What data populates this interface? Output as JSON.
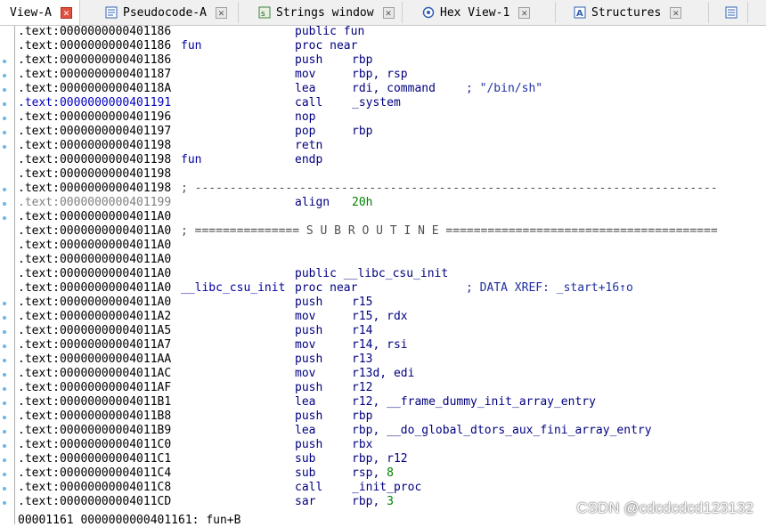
{
  "tabs": [
    {
      "label": "View-A",
      "icon": "ida-view-icon",
      "active": true
    },
    {
      "label": "Pseudocode-A",
      "icon": "pseudocode-icon",
      "active": false
    },
    {
      "label": "Strings window",
      "icon": "strings-icon",
      "active": false
    },
    {
      "label": "Hex View-1",
      "icon": "hex-view-icon",
      "active": false
    },
    {
      "label": "Structures",
      "icon": "structures-icon",
      "active": false
    }
  ],
  "listing": [
    {
      "addr": ".text:0000000000401186",
      "label": "",
      "mnem": "public fun",
      "ops": "",
      "comment": ""
    },
    {
      "addr": ".text:0000000000401186",
      "label": "fun",
      "mnem": "proc near",
      "ops": "",
      "comment": ""
    },
    {
      "addr": ".text:0000000000401186",
      "label": "",
      "mnem": "push",
      "ops": "rbp",
      "comment": ""
    },
    {
      "addr": ".text:0000000000401187",
      "label": "",
      "mnem": "mov",
      "ops": "rbp, rsp",
      "comment": ""
    },
    {
      "addr": ".text:000000000040118A",
      "label": "",
      "mnem": "lea",
      "ops": "rdi, command",
      "comment": "; \"/bin/sh\""
    },
    {
      "addr": ".text:0000000000401191",
      "label": "",
      "mnem": "call",
      "ops": "_system",
      "comment": ""
    },
    {
      "addr": ".text:0000000000401196",
      "label": "",
      "mnem": "nop",
      "ops": "",
      "comment": ""
    },
    {
      "addr": ".text:0000000000401197",
      "label": "",
      "mnem": "pop",
      "ops": "rbp",
      "comment": ""
    },
    {
      "addr": ".text:0000000000401198",
      "label": "",
      "mnem": "retn",
      "ops": "",
      "comment": ""
    },
    {
      "addr": ".text:0000000000401198",
      "label": "fun",
      "mnem": "endp",
      "ops": "",
      "comment": ""
    },
    {
      "addr": ".text:0000000000401198",
      "label": "",
      "mnem": "",
      "ops": "",
      "comment": ""
    },
    {
      "addr": ".text:0000000000401198",
      "sep": "; ---------------------------------------------------------------------------"
    },
    {
      "addr": ".text:0000000000401199",
      "label": "",
      "mnem": "align",
      "ops": "20h",
      "comment": ""
    },
    {
      "addr": ".text:00000000004011A0",
      "label": "",
      "mnem": "",
      "ops": "",
      "comment": ""
    },
    {
      "addr": ".text:00000000004011A0",
      "sep": "; =============== S U B R O U T I N E ======================================="
    },
    {
      "addr": ".text:00000000004011A0",
      "label": "",
      "mnem": "",
      "ops": "",
      "comment": ""
    },
    {
      "addr": ".text:00000000004011A0",
      "label": "",
      "mnem": "",
      "ops": "",
      "comment": ""
    },
    {
      "addr": ".text:00000000004011A0",
      "label": "",
      "mnem": "public __libc_csu_init",
      "ops": "",
      "comment": ""
    },
    {
      "addr": ".text:00000000004011A0",
      "label": "__libc_csu_init",
      "mnem": "proc near",
      "ops": "",
      "comment": "; DATA XREF: _start+16↑o"
    },
    {
      "addr": ".text:00000000004011A0",
      "label": "",
      "mnem": "push",
      "ops": "r15",
      "comment": ""
    },
    {
      "addr": ".text:00000000004011A2",
      "label": "",
      "mnem": "mov",
      "ops": "r15, rdx",
      "comment": ""
    },
    {
      "addr": ".text:00000000004011A5",
      "label": "",
      "mnem": "push",
      "ops": "r14",
      "comment": ""
    },
    {
      "addr": ".text:00000000004011A7",
      "label": "",
      "mnem": "mov",
      "ops": "r14, rsi",
      "comment": ""
    },
    {
      "addr": ".text:00000000004011AA",
      "label": "",
      "mnem": "push",
      "ops": "r13",
      "comment": ""
    },
    {
      "addr": ".text:00000000004011AC",
      "label": "",
      "mnem": "mov",
      "ops": "r13d, edi",
      "comment": ""
    },
    {
      "addr": ".text:00000000004011AF",
      "label": "",
      "mnem": "push",
      "ops": "r12",
      "comment": ""
    },
    {
      "addr": ".text:00000000004011B1",
      "label": "",
      "mnem": "lea",
      "ops": "r12, __frame_dummy_init_array_entry",
      "comment": ""
    },
    {
      "addr": ".text:00000000004011B8",
      "label": "",
      "mnem": "push",
      "ops": "rbp",
      "comment": ""
    },
    {
      "addr": ".text:00000000004011B9",
      "label": "",
      "mnem": "lea",
      "ops": "rbp, __do_global_dtors_aux_fini_array_entry",
      "comment": ""
    },
    {
      "addr": ".text:00000000004011C0",
      "label": "",
      "mnem": "push",
      "ops": "rbx",
      "comment": ""
    },
    {
      "addr": ".text:00000000004011C1",
      "label": "",
      "mnem": "sub",
      "ops": "rbp, r12",
      "comment": ""
    },
    {
      "addr": ".text:00000000004011C4",
      "label": "",
      "mnem": "sub",
      "ops": "rsp, 8",
      "comment": ""
    },
    {
      "addr": ".text:00000000004011C8",
      "label": "",
      "mnem": "call",
      "ops": "_init_proc",
      "comment": ""
    },
    {
      "addr": ".text:00000000004011CD",
      "label": "",
      "mnem": "sar",
      "ops": "rbp, 3",
      "comment": ""
    }
  ],
  "status_line": "00001161 0000000000401161: fun+B",
  "watermark": "CSDN @cdcdcdcd123132",
  "colors": {
    "address": "#000000",
    "highlight_address": "#0000c0",
    "code": "#000080",
    "number": "#008000",
    "comment": "#2030a0"
  }
}
